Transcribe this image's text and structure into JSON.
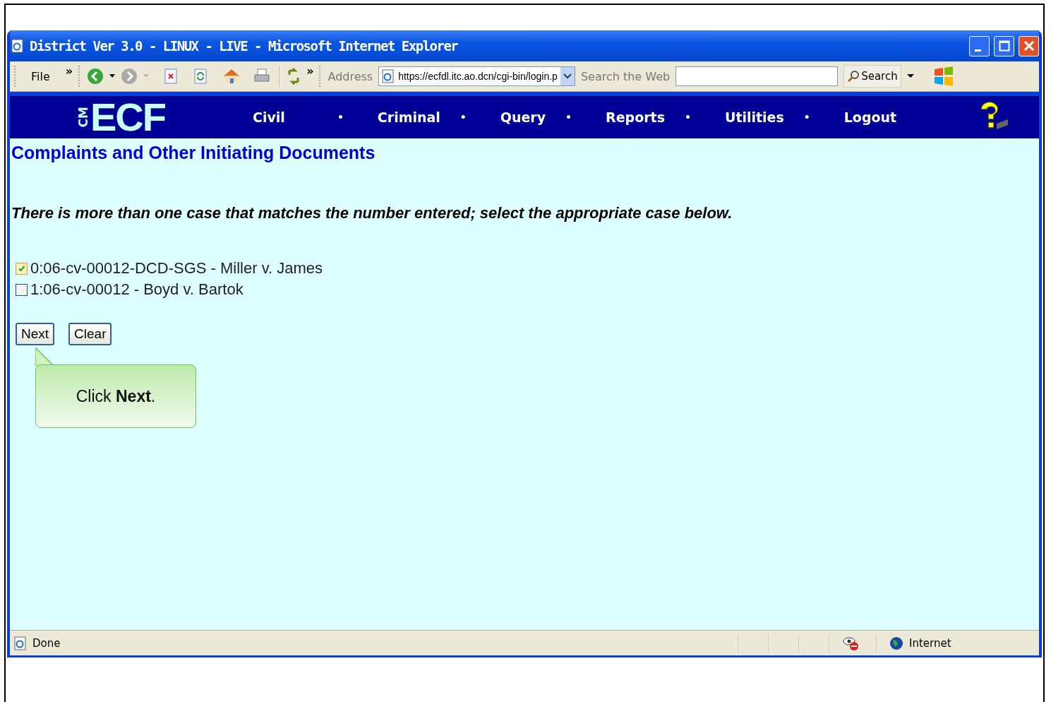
{
  "window": {
    "title": "District Ver 3.0 - LINUX - LIVE - Microsoft Internet Explorer"
  },
  "toolbar": {
    "menu": "File",
    "chevron_menu": "»",
    "chevron_buttons": "»",
    "address_label": "Address",
    "address": "https://ecfdl.itc.ao.dcn/cgi-bin/login.p",
    "search_label": "Search the Web",
    "search_button": "Search"
  },
  "nav": {
    "logo_small": "CM",
    "logo_big": "ECF",
    "items": [
      {
        "label": "Civil"
      },
      {
        "label": "Criminal"
      },
      {
        "label": "Query"
      },
      {
        "label": "Reports"
      },
      {
        "label": "Utilities"
      },
      {
        "label": "Logout"
      }
    ],
    "separator": "•"
  },
  "page": {
    "heading": "Complaints and Other Initiating Documents",
    "message": "There is more than one case that matches the number entered; select the appropriate case below.",
    "cases": [
      {
        "label": "0:06-cv-00012-DCD-SGS - Miller v. James",
        "checked": true
      },
      {
        "label": "1:06-cv-00012 - Boyd v. Bartok",
        "checked": false
      }
    ],
    "buttons": [
      "Next",
      "Clear"
    ],
    "callout": "Click **Next**."
  },
  "status_bar": {
    "status": "Done",
    "zone": "Internet"
  }
}
